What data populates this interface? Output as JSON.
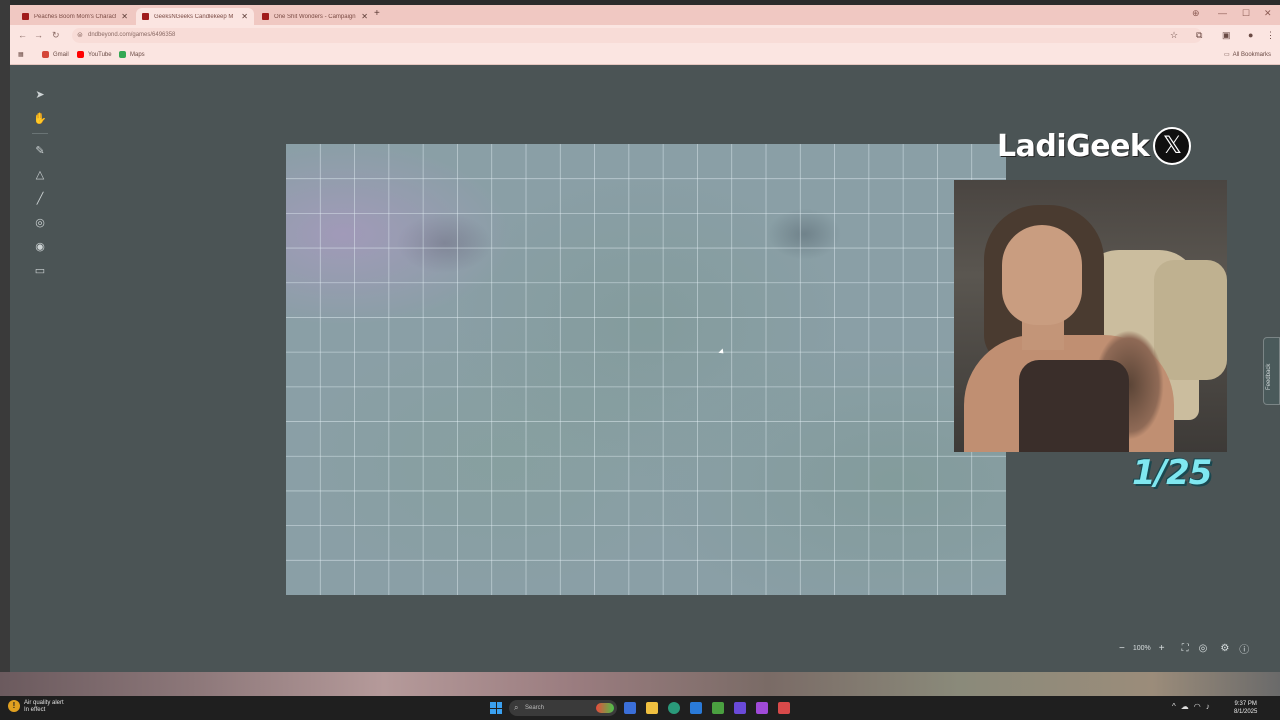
{
  "browser": {
    "tabs": [
      {
        "title": "Peaches Boom Mom's Charact",
        "active": false
      },
      {
        "title": "GeeksNGeeks Candlekeep M",
        "active": true
      },
      {
        "title": "One Shit Wonders - Campaign",
        "active": false
      }
    ],
    "url": "dndbeyond.com/games/6496358",
    "bookmarks": [
      {
        "label": "Gmail",
        "color": "#d44638"
      },
      {
        "label": "YouTube",
        "color": "#ff0000"
      },
      {
        "label": "Maps",
        "color": "#34a853"
      }
    ],
    "all_bookmarks": "All Bookmarks"
  },
  "toolbar": {
    "tools": [
      {
        "name": "select-tool",
        "icon": "cursor-arrow-icon",
        "glyph": "➤"
      },
      {
        "name": "pan-tool",
        "icon": "hand-icon",
        "glyph": "✋"
      },
      {
        "name": "draw-tool",
        "icon": "pencil-circle-icon",
        "glyph": "✎"
      },
      {
        "name": "shapes-tool",
        "icon": "shapes-icon",
        "glyph": "△"
      },
      {
        "name": "measure-tool",
        "icon": "ruler-icon",
        "glyph": "╱"
      },
      {
        "name": "ping-tool",
        "icon": "target-icon",
        "glyph": "◎"
      },
      {
        "name": "tokens-tool",
        "icon": "person-circle-icon",
        "glyph": "◉"
      },
      {
        "name": "notes-tool",
        "icon": "note-icon",
        "glyph": "▭"
      }
    ]
  },
  "map": {
    "grid_cols": 21,
    "grid_rows": 13
  },
  "feedback": {
    "label": "Feedback"
  },
  "zoom": {
    "value": "100%"
  },
  "overlay": {
    "brand": "LadiGeek",
    "social_icon": "x-logo-icon",
    "social_glyph": "𝕏",
    "counter": "1/25"
  },
  "taskbar": {
    "weather_title": "Air quality alert",
    "weather_sub": "In effect",
    "search_placeholder": "Search",
    "time": "9:37 PM",
    "date": "8/1/2025"
  },
  "colors": {
    "browser_tint": "#f0c8c2",
    "page_bg": "#4b5455",
    "counter": "#7fe7f0",
    "favicon": "#a01c1c"
  }
}
